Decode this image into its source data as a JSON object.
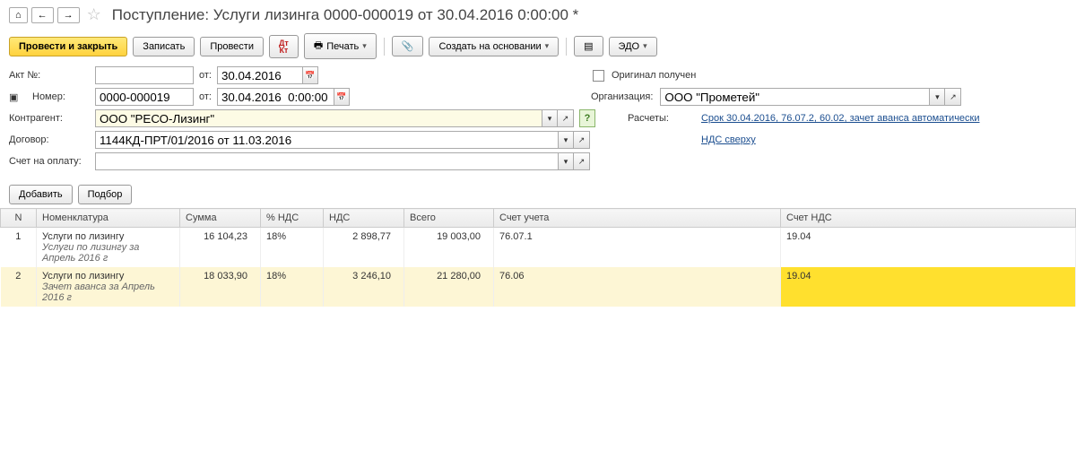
{
  "title": "Поступление: Услуги лизинга 0000-000019 от 30.04.2016 0:00:00 *",
  "toolbar": {
    "post_close": "Провести и закрыть",
    "save": "Записать",
    "post": "Провести",
    "print": "Печать",
    "create_based": "Создать на основании",
    "edo": "ЭДО"
  },
  "form": {
    "akt_label": "Акт №:",
    "ot_label": "от:",
    "date1": "30.04.2016",
    "nomer_label": "Номер:",
    "nomer": "0000-000019",
    "date2": "30.04.2016  0:00:00",
    "original_label": "Оригинал получен",
    "org_label": "Организация:",
    "org_value": "ООО \"Прометей\"",
    "kontragent_label": "Контрагент:",
    "kontragent_value": "ООО \"РЕСО-Лизинг\"",
    "raschety_label": "Расчеты:",
    "raschety_link": "Срок 30.04.2016, 76.07.2, 60.02, зачет аванса автоматически",
    "dogovor_label": "Договор:",
    "dogovor_value": "1144КД-ПРТ/01/2016 от 11.03.2016",
    "nds_link": "НДС сверху",
    "schet_label": "Счет на оплату:"
  },
  "table_btns": {
    "add": "Добавить",
    "pick": "Подбор"
  },
  "columns": {
    "n": "N",
    "nom": "Номенклатура",
    "sum": "Сумма",
    "pnds": "% НДС",
    "nds": "НДС",
    "total": "Всего",
    "acct": "Счет учета",
    "acct_nds": "Счет НДС"
  },
  "rows": [
    {
      "n": "1",
      "nom": "Услуги по лизингу",
      "sub": "Услуги по лизингу  за Апрель 2016 г",
      "sum": "16 104,23",
      "pnds": "18%",
      "nds": "2 898,77",
      "total": "19 003,00",
      "acct": "76.07.1",
      "acct_nds": "19.04"
    },
    {
      "n": "2",
      "nom": "Услуги по лизингу",
      "sub": "Зачет аванса за Апрель 2016 г",
      "sum": "18 033,90",
      "pnds": "18%",
      "nds": "3 246,10",
      "total": "21 280,00",
      "acct": "76.06",
      "acct_nds": "19.04"
    }
  ]
}
